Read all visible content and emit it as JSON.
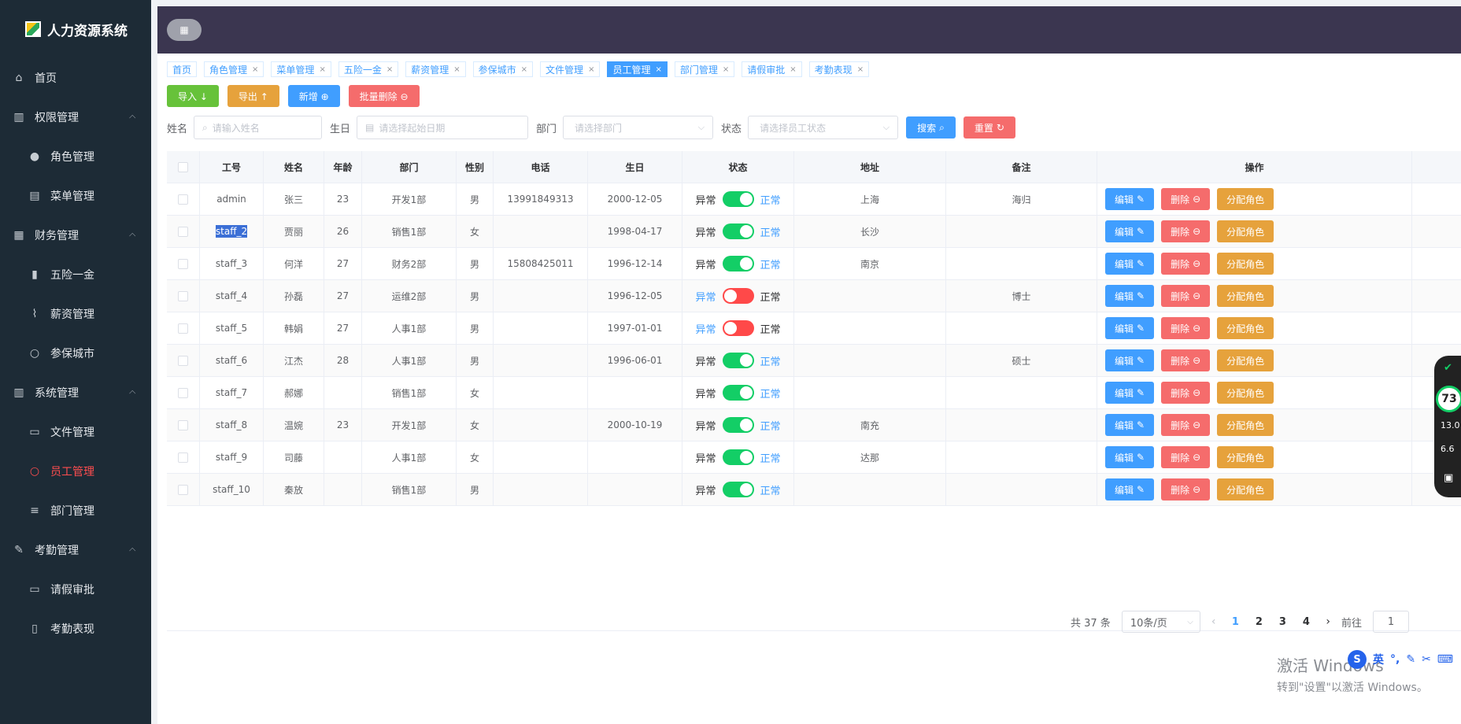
{
  "brand": {
    "title": "人力资源系统"
  },
  "sidebar": {
    "items": [
      {
        "label": "首页",
        "icon": "home-icon"
      },
      {
        "label": "权限管理",
        "icon": "bank-icon"
      },
      {
        "label": "角色管理",
        "icon": "user-icon"
      },
      {
        "label": "菜单管理",
        "icon": "document-icon"
      },
      {
        "label": "财务管理",
        "icon": "wallet-icon"
      },
      {
        "label": "五险一金",
        "icon": "bar-chart-icon"
      },
      {
        "label": "薪资管理",
        "icon": "line-chart-icon"
      },
      {
        "label": "参保城市",
        "icon": "person-icon"
      },
      {
        "label": "系统管理",
        "icon": "grid-icon"
      },
      {
        "label": "文件管理",
        "icon": "folder-icon"
      },
      {
        "label": "员工管理",
        "icon": "user-active-icon"
      },
      {
        "label": "部门管理",
        "icon": "sliders-icon"
      },
      {
        "label": "考勤管理",
        "icon": "edit-icon"
      },
      {
        "label": "请假审批",
        "icon": "briefcase-icon"
      },
      {
        "label": "考勤表现",
        "icon": "book-icon"
      }
    ]
  },
  "tabs": [
    {
      "label": "首页"
    },
    {
      "label": "角色管理"
    },
    {
      "label": "菜单管理"
    },
    {
      "label": "五险一金"
    },
    {
      "label": "薪资管理"
    },
    {
      "label": "参保城市"
    },
    {
      "label": "文件管理"
    },
    {
      "label": "员工管理"
    },
    {
      "label": "部门管理"
    },
    {
      "label": "请假审批"
    },
    {
      "label": "考勤表现"
    }
  ],
  "toolbar": {
    "import": "导入 ↓",
    "export": "导出 ↑",
    "add": "新增 ⊕",
    "batch_delete": "批量删除 ⊖"
  },
  "filters": {
    "name_label": "姓名",
    "name_placeholder": "请输入姓名",
    "birthday_label": "生日",
    "birthday_placeholder": "请选择起始日期",
    "dept_label": "部门",
    "dept_placeholder": "请选择部门",
    "status_label": "状态",
    "status_placeholder": "请选择员工状态",
    "search": "搜索",
    "reset": "重置"
  },
  "table": {
    "headers": [
      "工号",
      "姓名",
      "年龄",
      "部门",
      "性别",
      "电话",
      "生日",
      "状态",
      "地址",
      "备注",
      "操作"
    ],
    "status_abnormal": "异常",
    "status_normal": "正常",
    "op_edit": "编辑",
    "op_delete": "删除",
    "op_assign": "分配角色",
    "rows": [
      {
        "id": "admin",
        "name": "张三",
        "age": "23",
        "dept": "开发1部",
        "gender": "男",
        "phone": "13991849313",
        "birthday": "2000-12-05",
        "status": true,
        "address": "上海",
        "note": "海归"
      },
      {
        "id": "staff_2",
        "name": "贾丽",
        "age": "26",
        "dept": "销售1部",
        "gender": "女",
        "phone": "",
        "birthday": "1998-04-17",
        "status": true,
        "address": "长沙",
        "note": ""
      },
      {
        "id": "staff_3",
        "name": "何洋",
        "age": "27",
        "dept": "财务2部",
        "gender": "男",
        "phone": "15808425011",
        "birthday": "1996-12-14",
        "status": true,
        "address": "南京",
        "note": ""
      },
      {
        "id": "staff_4",
        "name": "孙磊",
        "age": "27",
        "dept": "运维2部",
        "gender": "男",
        "phone": "",
        "birthday": "1996-12-05",
        "status": false,
        "address": "",
        "note": "博士"
      },
      {
        "id": "staff_5",
        "name": "韩娟",
        "age": "27",
        "dept": "人事1部",
        "gender": "男",
        "phone": "",
        "birthday": "1997-01-01",
        "status": false,
        "address": "",
        "note": ""
      },
      {
        "id": "staff_6",
        "name": "江杰",
        "age": "28",
        "dept": "人事1部",
        "gender": "男",
        "phone": "",
        "birthday": "1996-06-01",
        "status": true,
        "address": "",
        "note": "硕士"
      },
      {
        "id": "staff_7",
        "name": "郝娜",
        "age": "",
        "dept": "销售1部",
        "gender": "女",
        "phone": "",
        "birthday": "",
        "status": true,
        "address": "",
        "note": ""
      },
      {
        "id": "staff_8",
        "name": "温婉",
        "age": "23",
        "dept": "开发1部",
        "gender": "女",
        "phone": "",
        "birthday": "2000-10-19",
        "status": true,
        "address": "南充",
        "note": ""
      },
      {
        "id": "staff_9",
        "name": "司藤",
        "age": "",
        "dept": "人事1部",
        "gender": "女",
        "phone": "",
        "birthday": "",
        "status": true,
        "address": "达那",
        "note": ""
      },
      {
        "id": "staff_10",
        "name": "秦放",
        "age": "",
        "dept": "销售1部",
        "gender": "男",
        "phone": "",
        "birthday": "",
        "status": true,
        "address": "",
        "note": ""
      }
    ]
  },
  "pagination": {
    "total": "共 37 条",
    "page_size": "10条/页",
    "pages": [
      "1",
      "2",
      "3",
      "4"
    ],
    "current": "1",
    "goto_label": "前往",
    "goto_value": "1"
  },
  "overlay": {
    "percent": "73",
    "up_speed": "13.0",
    "down_speed": "6.6",
    "watermark_line1": "激活 Windows",
    "watermark_line2": "转到\"设置\"以激活 Windows。",
    "ime_label": "英"
  },
  "colors": {
    "sidebar_bg": "#1d2b36",
    "header_bg": "#3b3650",
    "primary": "#409eff",
    "success": "#67c23a",
    "warning": "#e6a23c",
    "danger": "#f56c6c",
    "active_menu": "#ff4d4f"
  }
}
